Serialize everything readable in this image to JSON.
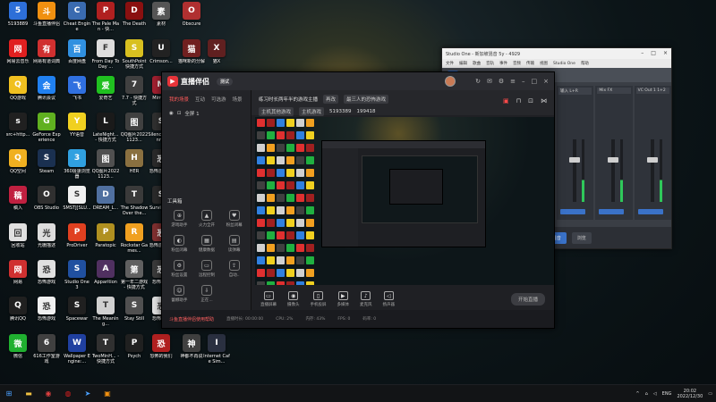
{
  "desktop": {
    "icons": [
      {
        "label": "5193889",
        "color": "#2d6fd8",
        "glyph": "5"
      },
      {
        "label": "斗鱼直播伴侣",
        "color": "#f09010",
        "glyph": "斗"
      },
      {
        "label": "Cheat Engine",
        "color": "#3a6bb0",
        "glyph": "C"
      },
      {
        "label": "The Pale Man - 快...",
        "color": "#b02020",
        "glyph": "P"
      },
      {
        "label": "The Death",
        "color": "#8a1010",
        "glyph": "D"
      },
      {
        "label": "素材",
        "color": "#555555",
        "glyph": "素"
      },
      {
        "label": "Obscure",
        "color": "#b03030",
        "glyph": "O"
      },
      {
        "label": "网易云音乐",
        "color": "#e02020",
        "glyph": "网"
      },
      {
        "label": "网易有道词典",
        "color": "#d03030",
        "glyph": "有"
      },
      {
        "label": "百度网盘",
        "color": "#3090e0",
        "glyph": "百"
      },
      {
        "label": "From Day To Day ...",
        "color": "#dddddd",
        "glyph": "F"
      },
      {
        "label": "SouthPoint 快捷方式",
        "color": "#d8c020",
        "glyph": "S"
      },
      {
        "label": "Crimson...",
        "color": "#222222",
        "glyph": "U"
      },
      {
        "label": "猫咪新的分解",
        "color": "#702020",
        "glyph": "猫"
      },
      {
        "label": "猫X",
        "color": "#602020",
        "glyph": "X"
      },
      {
        "label": "QQ游戏",
        "color": "#f0c020",
        "glyph": "Q"
      },
      {
        "label": "腾讯会议",
        "color": "#2080f0",
        "glyph": "会"
      },
      {
        "label": "飞书",
        "color": "#3070e0",
        "glyph": "飞"
      },
      {
        "label": "爱奇艺",
        "color": "#20c020",
        "glyph": "爱"
      },
      {
        "label": "7.7 - 快捷方式",
        "color": "#404040",
        "glyph": "7"
      },
      {
        "label": "Mirror 2",
        "color": "#a02030",
        "glyph": "M"
      },
      {
        "label": "src+http...",
        "color": "#202020",
        "glyph": "s"
      },
      {
        "label": "GeForce Experience",
        "color": "#60b020",
        "glyph": "G"
      },
      {
        "label": "YY语音",
        "color": "#f0d020",
        "glyph": "Y"
      },
      {
        "label": "LateNight... - 快捷方式",
        "color": "#1a1a1a",
        "glyph": "L"
      },
      {
        "label": "QQ图片20221123...",
        "color": "#404040",
        "glyph": "图"
      },
      {
        "label": "Silence Channel",
        "color": "#303030",
        "glyph": "S"
      },
      {
        "label": "QQ空间",
        "color": "#f0b020",
        "glyph": "Q"
      },
      {
        "label": "Steam",
        "color": "#1a3050",
        "glyph": "S"
      },
      {
        "label": "360极速浏览器",
        "color": "#30a0e0",
        "glyph": "3"
      },
      {
        "label": "QQ图片20221123...",
        "color": "#505050",
        "glyph": "图"
      },
      {
        "label": "HER",
        "color": "#8a7040",
        "glyph": "H"
      },
      {
        "label": "恐怖游戏 ...",
        "color": "#2a2a2a",
        "glyph": "恐"
      },
      {
        "label": "稿入",
        "color": "#c02040",
        "glyph": "稿"
      },
      {
        "label": "OBS Studio",
        "color": "#303030",
        "glyph": "O"
      },
      {
        "label": "SMSTJ[SLU...",
        "color": "#f0f0f0",
        "glyph": "S"
      },
      {
        "label": "DREAM_L...",
        "color": "#5070a0",
        "glyph": "D"
      },
      {
        "label": "The Shadow Over the...",
        "color": "#3a3a3a",
        "glyph": "T"
      },
      {
        "label": "SurviveT...",
        "color": "#2a2a2a",
        "glyph": "S"
      },
      {
        "label": "回收站",
        "color": "#e0e0e0",
        "glyph": "回"
      },
      {
        "label": "光栅描述",
        "color": "#dddddd",
        "glyph": "光"
      },
      {
        "label": "ProDriver",
        "color": "#e04020",
        "glyph": "P"
      },
      {
        "label": "Paratopic",
        "color": "#b09020",
        "glyph": "P"
      },
      {
        "label": "Rockstar Games...",
        "color": "#f0a020",
        "glyph": "R"
      },
      {
        "label": "恐怖游戏 ...",
        "color": "#803030",
        "glyph": "恐"
      },
      {
        "label": "网易",
        "color": "#d03030",
        "glyph": "网"
      },
      {
        "label": "恐怖游戏",
        "color": "#e0e0e0",
        "glyph": "恐"
      },
      {
        "label": "Studio One 3",
        "color": "#2050a0",
        "glyph": "S"
      },
      {
        "label": "Apparition",
        "color": "#503060",
        "glyph": "A"
      },
      {
        "label": "第一年二游戏 - 快捷方式",
        "color": "#606060",
        "glyph": "第"
      },
      {
        "label": "恐怖游戏",
        "color": "#3a3a3a",
        "glyph": "恐"
      },
      {
        "label": "腾讯QQ",
        "color": "#202020",
        "glyph": "Q"
      },
      {
        "label": "恐怖游戏",
        "color": "#f0f0f0",
        "glyph": "恐"
      },
      {
        "label": "Spacewar",
        "color": "#202020",
        "glyph": "S"
      },
      {
        "label": "The Meaning...",
        "color": "#d0d0d0",
        "glyph": "T"
      },
      {
        "label": "Stay Still",
        "color": "#505050",
        "glyph": "S"
      },
      {
        "label": "恐怖游戏",
        "color": "#e0e0e0",
        "glyph": "恐"
      },
      {
        "label": "微信",
        "color": "#20b030",
        "glyph": "微"
      },
      {
        "label": "616工作室游戏",
        "color": "#404040",
        "glyph": "6"
      },
      {
        "label": "Wallpaper Engine:...",
        "color": "#2040a0",
        "glyph": "W"
      },
      {
        "label": "TwoMinH... - 快捷方式",
        "color": "#303030",
        "glyph": "T"
      },
      {
        "label": "Psych",
        "color": "#202020",
        "glyph": "P"
      },
      {
        "label": "恐怖的我们",
        "color": "#b02020",
        "glyph": "恐"
      },
      {
        "label": "神都不再说",
        "color": "#404040",
        "glyph": "神"
      },
      {
        "label": "Internet Cafe Sim...",
        "color": "#2a3040",
        "glyph": "I"
      }
    ]
  },
  "stream": {
    "app_name": "直播伴侣",
    "version_badge": "测试",
    "left_tabs": [
      "我的场景",
      "互动",
      "可选游",
      "场景"
    ],
    "scene": "全屏 1",
    "room_title": "练习时长两年半的游戏主播",
    "room_chips": [
      "再改",
      "最三人的恐怖游戏"
    ],
    "room_chips2": [
      "主机其他游戏",
      "主机游戏"
    ],
    "room_id": "5193389",
    "room_fans": "199418",
    "tools_title": "工具箱",
    "tools": [
      "游戏助手",
      "火力全开",
      "粉丝闭幕",
      "粉丝闭幕",
      "健康数据",
      "读弹幕",
      "粉丝设置",
      "远程控制",
      "自动..",
      "蕾娜助手",
      "正在..."
    ],
    "controls": [
      "直播屏幕",
      "摄像头",
      "手机投屏",
      "多媒体",
      "麦克风",
      "扬声器"
    ],
    "golive": "开始直播",
    "status": [
      "直播时长: 00:00:00",
      "CPU: 2%",
      "内存: 43%",
      "FPS: 0",
      "码率: 0"
    ],
    "adv": "斗鱼直播伴侣使用帮助"
  },
  "studio": {
    "title": "Studio One - 新加坡混音 5y - 4929",
    "menu": [
      "文件",
      "编辑",
      "歌曲",
      "音轨",
      "事件",
      "音频",
      "传输",
      "视图",
      "Studio One",
      "帮助"
    ],
    "toolbar": [
      "开始",
      "歌曲",
      "项目"
    ],
    "strips": [
      "输入 L+R",
      "Mix FX",
      "VC Out 1 1+2"
    ],
    "bottom_buttons": [
      "编辑",
      "混音",
      "浏览"
    ],
    "strip_bottom": "主输出"
  },
  "taskbar": {
    "lang": "ENG",
    "time": "20:02",
    "date": "2022/12/30"
  }
}
